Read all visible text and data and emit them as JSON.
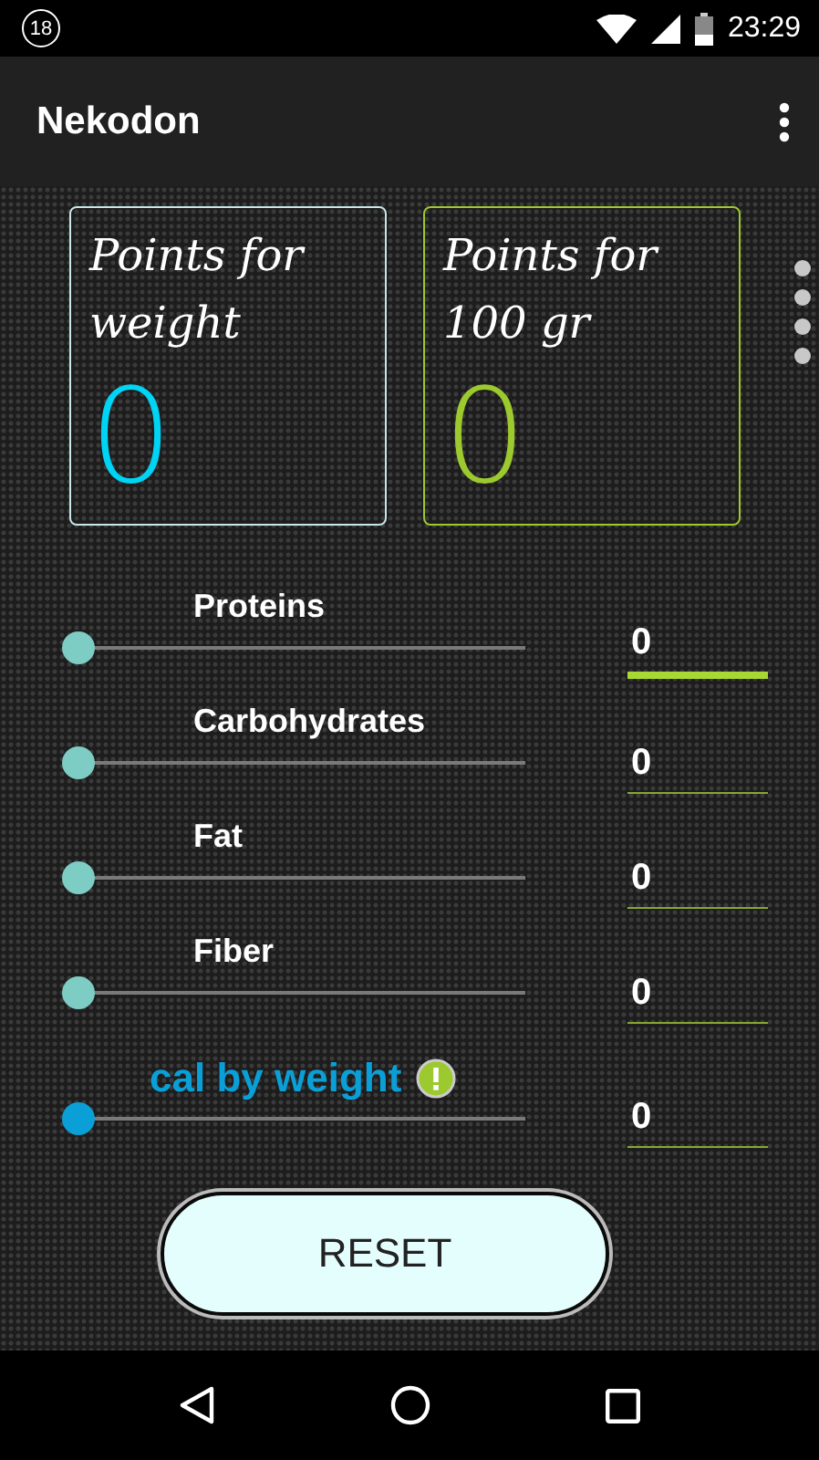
{
  "status_bar": {
    "notification": "18",
    "time": "23:29"
  },
  "app_bar": {
    "title": "Nekodon"
  },
  "cards": [
    {
      "kind": "weight",
      "title": "Points for weight",
      "value": "0",
      "color": "#00d4f5"
    },
    {
      "kind": "per100",
      "title": "Points for 100 gr",
      "value": "0",
      "color": "#9cc92e"
    }
  ],
  "rows": [
    {
      "kind": "nutrient",
      "label": "Proteins",
      "level": 0,
      "value": "0",
      "focused": true
    },
    {
      "kind": "nutrient",
      "label": "Carbohydrates",
      "level": 0,
      "value": "0",
      "focused": false
    },
    {
      "kind": "nutrient",
      "label": "Fat",
      "level": 0,
      "value": "0",
      "focused": false
    },
    {
      "kind": "nutrient",
      "label": "Fiber",
      "level": 0,
      "value": "0",
      "focused": false
    },
    {
      "kind": "calories",
      "label": "cal by weight",
      "level": 0,
      "value": "0",
      "focused": false
    }
  ],
  "reset_button": {
    "label": "RESET"
  }
}
